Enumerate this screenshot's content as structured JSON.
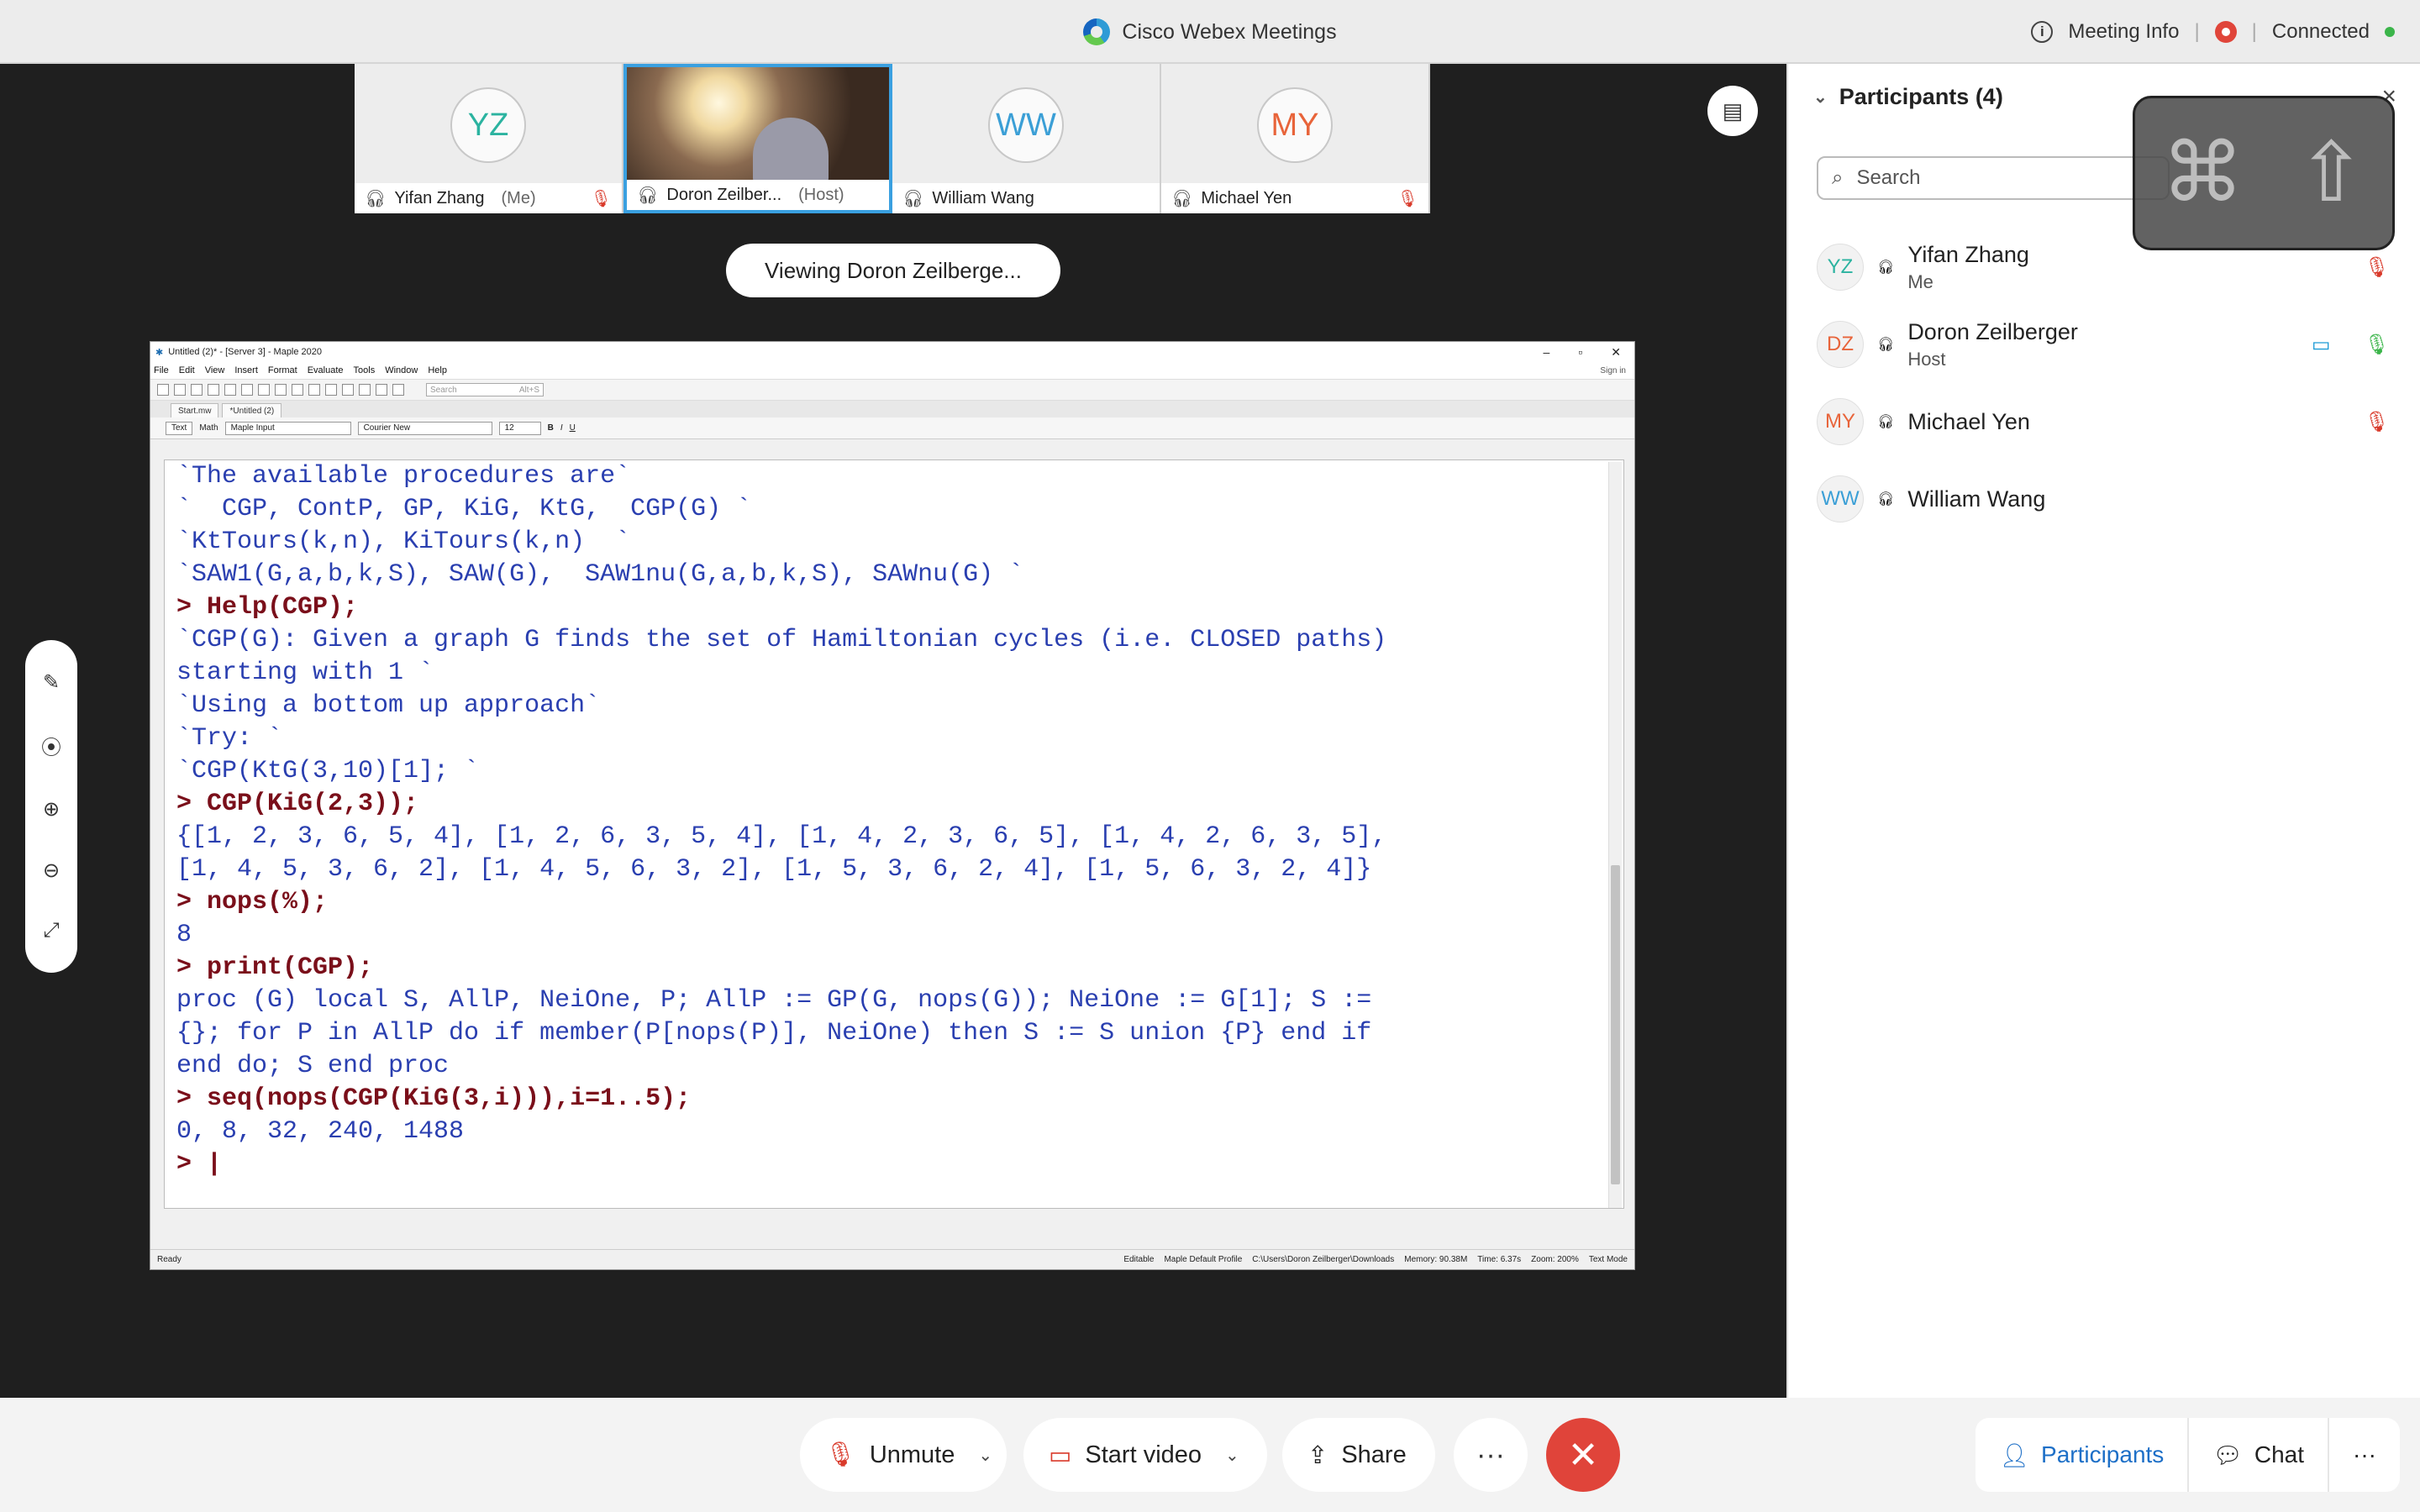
{
  "titlebar": {
    "app_name": "Cisco Webex Meetings",
    "meeting_info": "Meeting Info",
    "status": "Connected",
    "separator": "|"
  },
  "strip": {
    "tiles": [
      {
        "initials": "YZ",
        "name": "Yifan Zhang",
        "role": "(Me)",
        "initials_color": "#2bb3a0",
        "muted": true
      },
      {
        "initials": "",
        "name": "Doron Zeilber...",
        "role": "(Host)",
        "muted": false
      },
      {
        "initials": "WW",
        "name": "William Wang",
        "role": "",
        "initials_color": "#3b9fd6",
        "muted": false
      },
      {
        "initials": "MY",
        "name": "Michael Yen",
        "role": "",
        "initials_color": "#e8643a",
        "muted": true
      }
    ]
  },
  "viewing": "Viewing Doron Zeilberge...",
  "maple": {
    "title": "Untitled (2)* - [Server 3] - Maple 2020",
    "menu": [
      "File",
      "Edit",
      "View",
      "Insert",
      "Format",
      "Evaluate",
      "Tools",
      "Window",
      "Help"
    ],
    "signin": "Sign in",
    "search_placeholder": "Search",
    "search_shortcut": "Alt+S",
    "tabs": [
      "Start.mw",
      "*Untitled (2)"
    ],
    "fmt": {
      "text": "Text",
      "math": "Math",
      "style": "Maple Input",
      "font": "Courier New",
      "size": "12"
    },
    "lines": [
      {
        "kind": "out",
        "text": "`The available procedures are`"
      },
      {
        "kind": "out",
        "text": "`  CGP, ContP, GP, KiG, KtG,  CGP(G) `"
      },
      {
        "kind": "out",
        "text": "`KtTours(k,n), KiTours(k,n)  `"
      },
      {
        "kind": "out",
        "text": "`SAW1(G,a,b,k,S), SAW(G),  SAW1nu(G,a,b,k,S), SAWnu(G) `"
      },
      {
        "kind": "in",
        "text": "> Help(CGP);"
      },
      {
        "kind": "out",
        "text": "`CGP(G): Given a graph G finds the set of Hamiltonian cycles (i.e. CLOSED paths)"
      },
      {
        "kind": "out",
        "text": "starting with 1 `"
      },
      {
        "kind": "out",
        "text": "`Using a bottom up approach`"
      },
      {
        "kind": "out",
        "text": "`Try: `"
      },
      {
        "kind": "out",
        "text": "`CGP(KtG(3,10)[1]; `"
      },
      {
        "kind": "in",
        "text": "> CGP(KiG(2,3));"
      },
      {
        "kind": "out",
        "text": "{[1, 2, 3, 6, 5, 4], [1, 2, 6, 3, 5, 4], [1, 4, 2, 3, 6, 5], [1, 4, 2, 6, 3, 5],"
      },
      {
        "kind": "out",
        "text": "[1, 4, 5, 3, 6, 2], [1, 4, 5, 6, 3, 2], [1, 5, 3, 6, 2, 4], [1, 5, 6, 3, 2, 4]}"
      },
      {
        "kind": "in",
        "text": "> nops(%);"
      },
      {
        "kind": "out",
        "text": "8"
      },
      {
        "kind": "in",
        "text": "> print(CGP);"
      },
      {
        "kind": "out",
        "text": "proc (G) local S, AllP, NeiOne, P; AllP := GP(G, nops(G)); NeiOne := G[1]; S :="
      },
      {
        "kind": "out",
        "text": "{}; for P in AllP do if member(P[nops(P)], NeiOne) then S := S union {P} end if"
      },
      {
        "kind": "out",
        "text": "end do; S end proc"
      },
      {
        "kind": "in",
        "text": "> seq(nops(CGP(KiG(3,i))),i=1..5);"
      },
      {
        "kind": "out",
        "text": "0, 8, 32, 240, 1488"
      },
      {
        "kind": "in",
        "text": "> |"
      }
    ],
    "status": {
      "ready": "Ready",
      "editable": "Editable",
      "profile": "Maple Default Profile",
      "path": "C:\\Users\\Doron Zeilberger\\Downloads",
      "memory": "Memory: 90.38M",
      "time": "Time: 6.37s",
      "zoom": "Zoom: 200%",
      "mode": "Text Mode"
    }
  },
  "panel": {
    "title": "Participants (4)",
    "search_placeholder": "Search",
    "participants": [
      {
        "initials": "YZ",
        "name": "Yifan Zhang",
        "role": "Me",
        "initials_color": "#2bb3a0",
        "muted": true
      },
      {
        "initials": "DZ",
        "name": "Doron Zeilberger",
        "role": "Host",
        "initials_color": "#e8643a",
        "muted": false,
        "video": true
      },
      {
        "initials": "MY",
        "name": "Michael Yen",
        "role": "",
        "initials_color": "#e8643a",
        "muted": true
      },
      {
        "initials": "WW",
        "name": "William Wang",
        "role": "",
        "initials_color": "#3b9fd6",
        "muted": false
      }
    ]
  },
  "controls": {
    "unmute": "Unmute",
    "start_video": "Start video",
    "share": "Share",
    "more": "···",
    "participants": "Participants",
    "chat": "Chat"
  },
  "colors": {
    "accent": "#1d6fc7",
    "end_call": "#e0443a",
    "mute": "#d93a2b",
    "connected": "#3bb54a"
  }
}
